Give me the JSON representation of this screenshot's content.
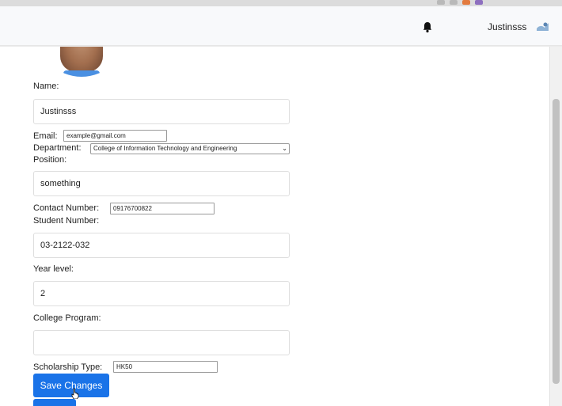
{
  "header": {
    "username": "Justinsss",
    "icons": {
      "notification": "bell-icon",
      "user": "user-avatar-icon"
    }
  },
  "form": {
    "name": {
      "label": "Name:",
      "value": "Justinsss"
    },
    "email": {
      "label": "Email:",
      "value": "example@gmail.com"
    },
    "department": {
      "label": "Department:",
      "selected": "College of Information Technology and Engineering"
    },
    "position": {
      "label": "Position:",
      "value": "something"
    },
    "contact_number": {
      "label": "Contact Number:",
      "value": "09176700822"
    },
    "student_number": {
      "label": "Student Number:",
      "value": "03-2122-032"
    },
    "year_level": {
      "label": "Year level:",
      "value": "2"
    },
    "college_program": {
      "label": "College Program:",
      "value": ""
    },
    "scholarship_type": {
      "label": "Scholarship Type:",
      "value": "HK50"
    },
    "save_label": "Save Changes"
  },
  "colors": {
    "primary_button": "#1a73e8",
    "page_background": "#ffffff",
    "topbar_background": "#f8f9fb"
  }
}
